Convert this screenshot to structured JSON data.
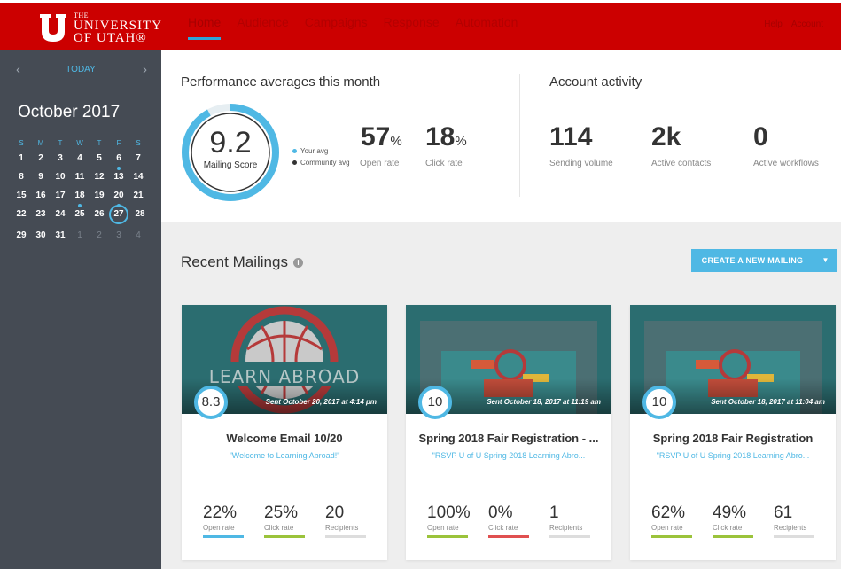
{
  "brand": {
    "the": "THE",
    "line1": "UNIVERSITY",
    "line2": "OF UTAH®"
  },
  "nav": [
    "Home",
    "Audience",
    "Campaigns",
    "Response",
    "Automation"
  ],
  "top_right": [
    "Help",
    "Account"
  ],
  "calendar": {
    "today_label": "TODAY",
    "month": "October 2017",
    "days_head": [
      "S",
      "M",
      "T",
      "W",
      "T",
      "F",
      "S"
    ],
    "weeks": [
      [
        "1",
        "2",
        "3",
        "4",
        "5",
        "6",
        "7"
      ],
      [
        "8",
        "9",
        "10",
        "11",
        "12",
        "13",
        "14"
      ],
      [
        "15",
        "16",
        "17",
        "18",
        "19",
        "20",
        "21"
      ],
      [
        "22",
        "23",
        "24",
        "25",
        "26",
        "27",
        "28"
      ],
      [
        "29",
        "30",
        "31",
        "1",
        "2",
        "3",
        "4"
      ]
    ]
  },
  "performance": {
    "title": "Performance averages this month",
    "score": "9.2",
    "score_label": "Mailing Score",
    "score_fraction": 0.92,
    "legend_your": "Your avg",
    "legend_community": "Community avg",
    "open_rate": "57",
    "open_rate_label": "Open rate",
    "click_rate": "18",
    "click_rate_label": "Click rate",
    "percent": "%"
  },
  "account": {
    "title": "Account activity",
    "sending_volume": "114",
    "sending_volume_label": "Sending volume",
    "active_contacts": "2k",
    "active_contacts_label": "Active contacts",
    "active_workflows": "0",
    "active_workflows_label": "Active workflows"
  },
  "recent": {
    "title": "Recent Mailings",
    "create_label": "CREATE A NEW MAILING",
    "info_icon": "info-icon"
  },
  "labels": {
    "open": "Open rate",
    "click": "Click rate",
    "recipients": "Recipients"
  },
  "cards": [
    {
      "score": "8.3",
      "sent": "Sent October 20, 2017 at 4:14 pm",
      "title": "Welcome Email 10/20",
      "subtitle": "\"Welcome to Learning Abroad!\"",
      "banner_text": "LEARN ABROAD",
      "open": "22%",
      "click": "25%",
      "recipients": "20"
    },
    {
      "score": "10",
      "sent": "Sent October 18, 2017 at 11:19 am",
      "title": "Spring 2018 Fair Registration - ...",
      "subtitle": "\"RSVP U of U Spring 2018 Learning Abro...",
      "open": "100%",
      "click": "0%",
      "recipients": "1"
    },
    {
      "score": "10",
      "sent": "Sent October 18, 2017 at 11:04 am",
      "title": "Spring 2018 Fair Registration",
      "subtitle": "\"RSVP U of U Spring 2018 Learning Abro...",
      "open": "62%",
      "click": "49%",
      "recipients": "61"
    }
  ],
  "colors": {
    "brand_red": "#cc0000",
    "accent_blue": "#4fb8e4",
    "sidebar": "#454b54",
    "bar_green": "#9bc33b",
    "bar_red": "#e05050",
    "bar_gray": "#dddddd"
  }
}
